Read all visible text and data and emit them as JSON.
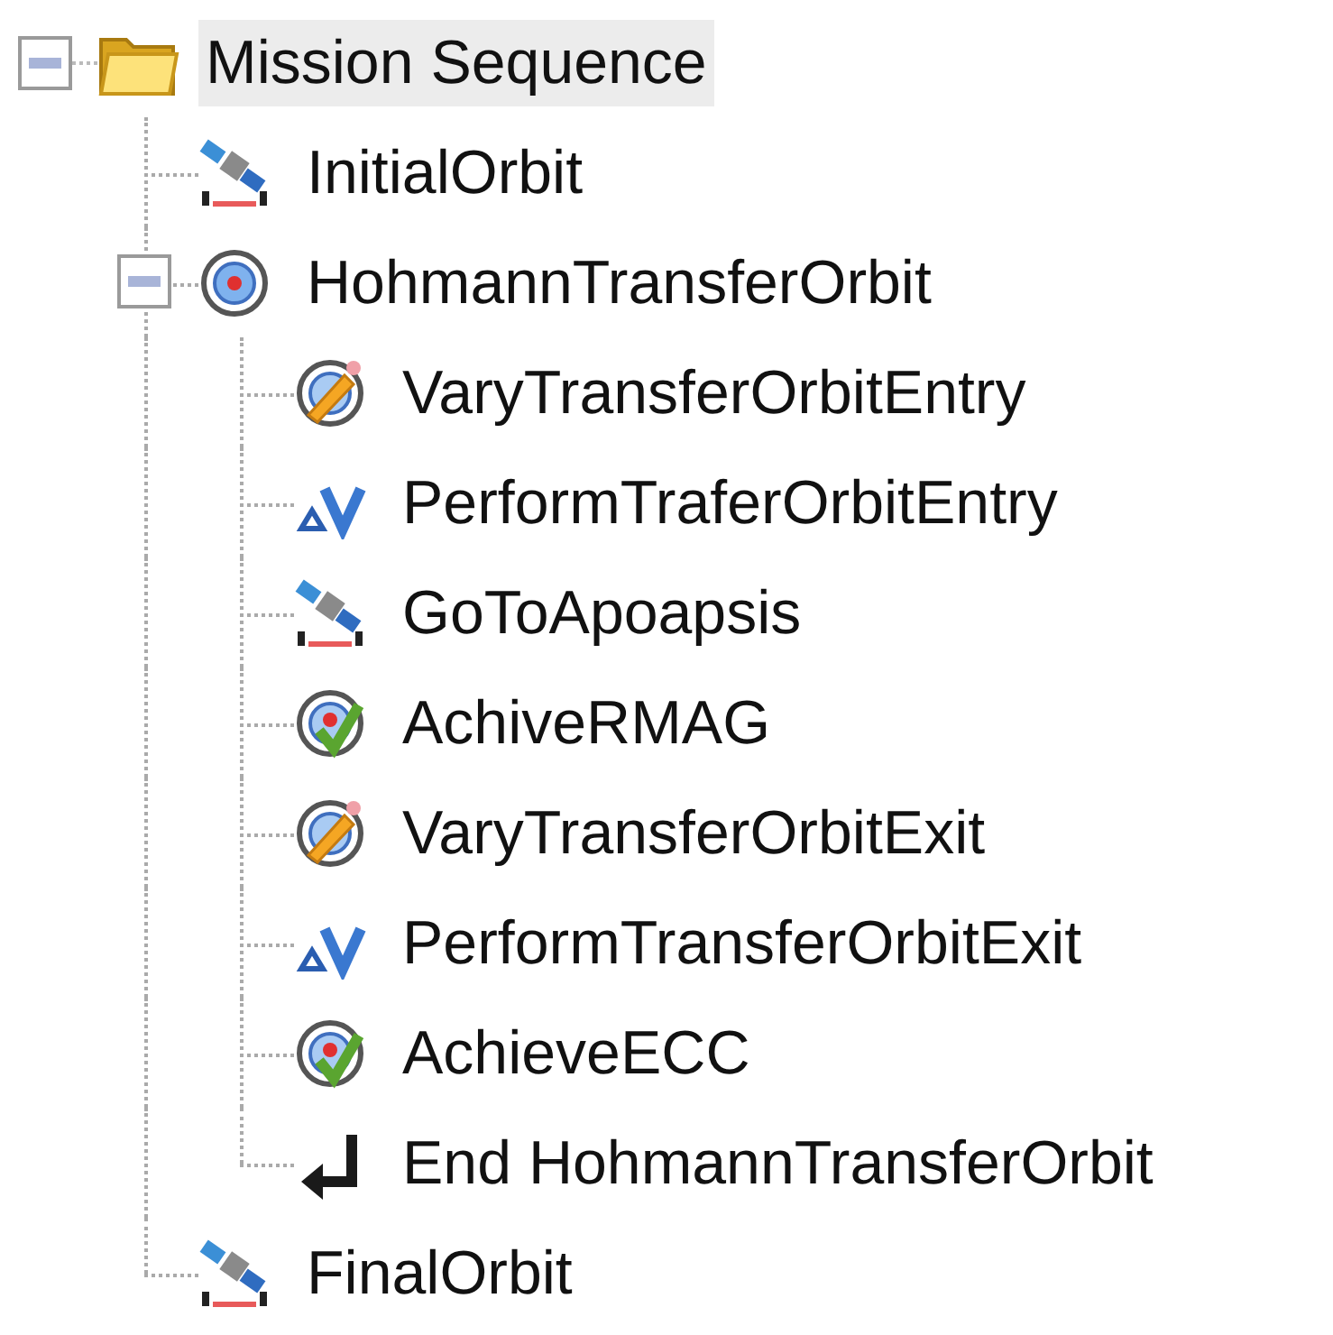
{
  "tree": {
    "label": "Mission Sequence",
    "kind": "folder",
    "selected": true,
    "expanded": true,
    "children": [
      {
        "label": "InitialOrbit",
        "kind": "propagate",
        "selected": false
      },
      {
        "label": "HohmannTransferOrbit",
        "kind": "target",
        "selected": false,
        "expanded": true,
        "children": [
          {
            "label": "VaryTransferOrbitEntry",
            "kind": "vary",
            "selected": false
          },
          {
            "label": "PerformTraferOrbitEntry",
            "kind": "maneuver",
            "selected": false
          },
          {
            "label": "GoToApoapsis",
            "kind": "propagate",
            "selected": false
          },
          {
            "label": "AchiveRMAG",
            "kind": "achieve",
            "selected": false
          },
          {
            "label": "VaryTransferOrbitExit",
            "kind": "vary",
            "selected": false
          },
          {
            "label": "PerformTransferOrbitExit",
            "kind": "maneuver",
            "selected": false
          },
          {
            "label": "AchieveECC",
            "kind": "achieve",
            "selected": false
          },
          {
            "label": "End HohmannTransferOrbit",
            "kind": "end",
            "selected": false
          }
        ]
      },
      {
        "label": "FinalOrbit",
        "kind": "propagate",
        "selected": false
      }
    ]
  }
}
